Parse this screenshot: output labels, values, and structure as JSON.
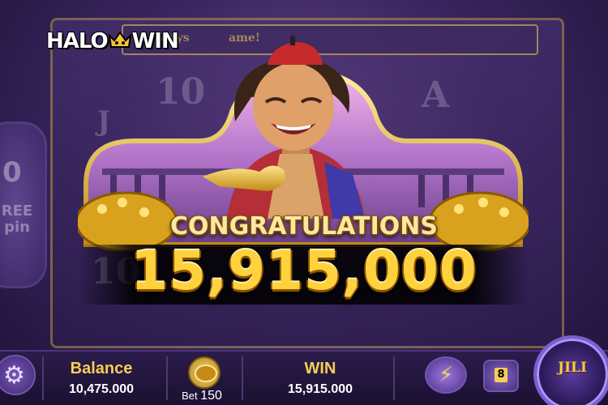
{
  "logo": {
    "text_left": "HALO",
    "text_right": "WIN"
  },
  "reel_header": {
    "left": "Ways",
    "right": "ame!"
  },
  "free_spin": {
    "number": "0",
    "line1": "REE",
    "line2": "pin"
  },
  "win_popup": {
    "congrats": "CONGRATULATIONS",
    "amount": "15,915,000"
  },
  "bottom_bar": {
    "balance_label": "Balance",
    "balance_value": "10,475.000",
    "bet_label": "Bet",
    "bet_value": "150",
    "win_label": "WIN",
    "win_value": "15,915.000",
    "auto_count": "8",
    "spin_brand": "JILI"
  },
  "icons": [
    "settings-gear-icon",
    "coin-stack-icon",
    "lightning-icon",
    "crown-icon"
  ],
  "colors": {
    "gold": "#ffd23d",
    "label_gold": "#f4cf55",
    "purple_bg": "#3b2660"
  }
}
